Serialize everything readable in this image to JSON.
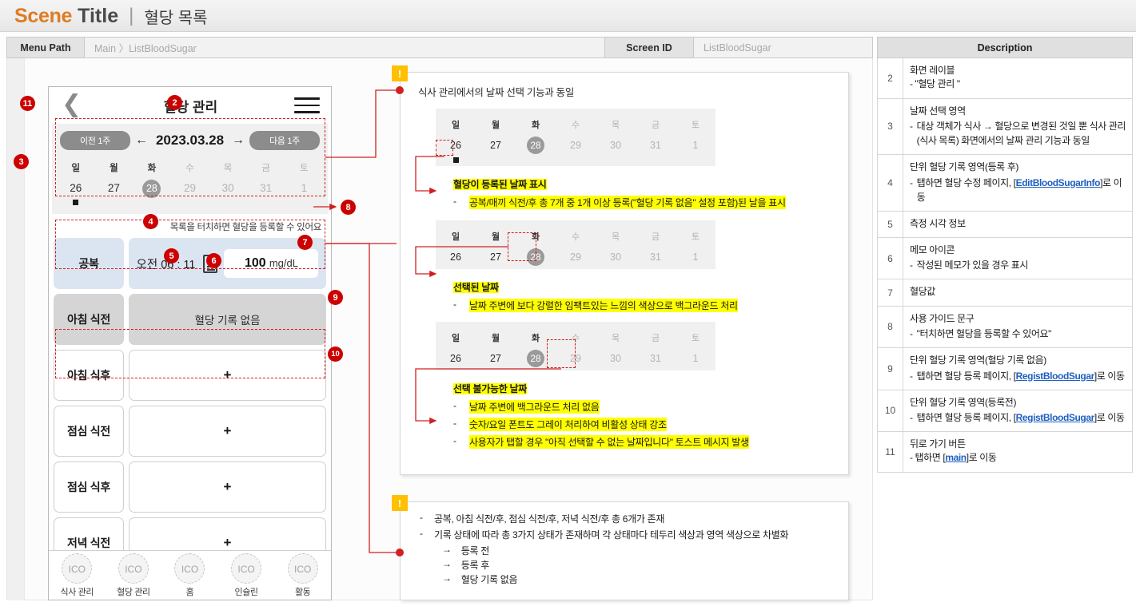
{
  "title": {
    "scene": "Scene",
    "title": "Title",
    "divider": "|",
    "subtitle": "혈당 목록"
  },
  "meta": {
    "menu_path_label": "Menu Path",
    "menu_path_value": "Main 〉ListBloodSugar",
    "screen_id_label": "Screen ID",
    "screen_id_value": "ListBloodSugar",
    "description_label": "Description"
  },
  "phone": {
    "back_icon": "back-chevron-icon",
    "header_title": "혈당 관리",
    "menu_icon": "hamburger-menu-icon",
    "date": {
      "prev_week": "이전 1주",
      "next_week": "다음 1주",
      "left_arrow": "←",
      "right_arrow": "→",
      "current": "2023.03.28",
      "days": [
        {
          "dow": "일",
          "num": "26",
          "state": "normal",
          "dot": true
        },
        {
          "dow": "월",
          "num": "27",
          "state": "normal",
          "dot": false
        },
        {
          "dow": "화",
          "num": "28",
          "state": "selected",
          "dot": false
        },
        {
          "dow": "수",
          "num": "29",
          "state": "disabled",
          "dot": false
        },
        {
          "dow": "목",
          "num": "30",
          "state": "disabled",
          "dot": false
        },
        {
          "dow": "금",
          "num": "31",
          "state": "disabled",
          "dot": false
        },
        {
          "dow": "토",
          "num": "1",
          "state": "disabled",
          "dot": false
        }
      ]
    },
    "guide_text": "목록을 터치하면 혈당을 등록할 수 있어요",
    "records": [
      {
        "label": "공복",
        "state": "after",
        "time": "오전 06 : 11",
        "memo": true,
        "value": "100",
        "unit": "mg/dL"
      },
      {
        "label": "아침 식전",
        "state": "none",
        "body_text": "혈당 기록 없음"
      },
      {
        "label": "아침 식후",
        "state": "pre",
        "body_text": "+"
      },
      {
        "label": "점심 식전",
        "state": "pre",
        "body_text": "+"
      },
      {
        "label": "점심 식후",
        "state": "pre",
        "body_text": "+"
      },
      {
        "label": "저녁 식전",
        "state": "pre",
        "body_text": "+"
      }
    ],
    "nav": [
      {
        "icon": "ICO",
        "label": "식사 관리"
      },
      {
        "icon": "ICO",
        "label": "혈당 관리"
      },
      {
        "icon": "ICO",
        "label": "홈"
      },
      {
        "icon": "ICO",
        "label": "인슐린"
      },
      {
        "icon": "ICO",
        "label": "활동"
      }
    ]
  },
  "badges": [
    "2",
    "3",
    "4",
    "5",
    "6",
    "7",
    "8",
    "9",
    "10",
    "11"
  ],
  "note_top": {
    "bang": "!",
    "headline": "식사 관리에서의 날짜 선택 기능과 동일",
    "cal_days": [
      "일",
      "월",
      "화",
      "수",
      "목",
      "금",
      "토"
    ],
    "cal_nums": [
      "26",
      "27",
      "28",
      "29",
      "30",
      "31",
      "1"
    ],
    "block1_title": "혈당이 등록된 날짜 표시",
    "block1_item": "공복/매끼 식전/후 총 7개 중 1개 이상 등록(\"혈당 기록 없음\" 설정 포함)된 날을 표시",
    "block2_title": "선택된 날짜",
    "block2_item": "날짜 주변에 보다 강렬한 임팩트있는 느낌의 색상으로 백그라운드 처리",
    "block3_title": "선택 불가능한 날짜",
    "block3_items": [
      "날짜 주변에 백그라운드 처리 없음",
      "숫자/요일 폰트도 그레이 처리하여 비활성 상태 강조",
      "사용자가 탭할 경우 \"아직 선택할 수 없는 날짜입니다\" 토스트 메시지 발생"
    ]
  },
  "note_bottom": {
    "bang": "!",
    "items": [
      "공복, 아침 식전/후, 점심 식전/후, 저녁 식전/후 총 6개가 존재",
      "기록 상태에 따라 총 3가지 상태가 존재하며 각 상태마다 테두리 색상과 영역 색상으로 차별화"
    ],
    "arrows": [
      "등록 전",
      "등록 후",
      "혈당 기록 없음"
    ]
  },
  "descriptions": [
    {
      "num": "2",
      "title": "화면 레이블",
      "lines": [
        {
          "dash": "-",
          "text": "\"혈당 관리 \"",
          "nodash": true
        }
      ]
    },
    {
      "num": "3",
      "title": "날짜 선택 영역",
      "lines": [
        {
          "dash": "-",
          "text": "대상 객체가 식사 → 혈당으로 변경된 것일 뿐 식사 관리(식사 목록) 화면에서의 날짜 관리 기능과 동일"
        }
      ]
    },
    {
      "num": "4",
      "title": "단위 혈당 기록 영역(등록 후)",
      "lines": [
        {
          "dash": "-",
          "text": "탭하면 혈당 수정 페이지, ",
          "link": "EditBloodSugarInfo",
          "pre": "[",
          "post": "]로 이동"
        }
      ]
    },
    {
      "num": "5",
      "title": "측정 시각 정보",
      "lines": []
    },
    {
      "num": "6",
      "title": "메모 아이콘",
      "lines": [
        {
          "dash": "-",
          "text": "작성된 메모가 있을 경우 표시"
        }
      ]
    },
    {
      "num": "7",
      "title": "혈당값",
      "lines": []
    },
    {
      "num": "8",
      "title": "사용 가이드 문구",
      "lines": [
        {
          "dash": "-",
          "text": "\"터치하면 혈당을 등록할 수 있어요\""
        }
      ]
    },
    {
      "num": "9",
      "title": "단위 혈당 기록 영역(혈당 기록 없음)",
      "lines": [
        {
          "dash": "-",
          "text": "탭하면 혈당 등록 페이지, ",
          "link": "RegistBloodSugar",
          "pre": "[",
          "post": "]로 이동"
        }
      ]
    },
    {
      "num": "10",
      "title": "단위 혈당 기록 영역(등록전)",
      "lines": [
        {
          "dash": "-",
          "text": "탭하면 혈당 등록 페이지, ",
          "link": "RegistBloodSugar",
          "pre": "[",
          "post": "]로 이동"
        }
      ]
    },
    {
      "num": "11",
      "title": "뒤로 가기 버튼",
      "lines": [
        {
          "dash": "-",
          "text": "탭하면 ",
          "link": "main",
          "pre": "[",
          "post": "]로 이동",
          "nodash": true
        }
      ]
    }
  ],
  "colors": {
    "accent": "#e07b22",
    "badge": "#cc0000",
    "highlight": "#ffff00",
    "link": "#1f5fbf",
    "selected_day": "#9a9a9a"
  }
}
